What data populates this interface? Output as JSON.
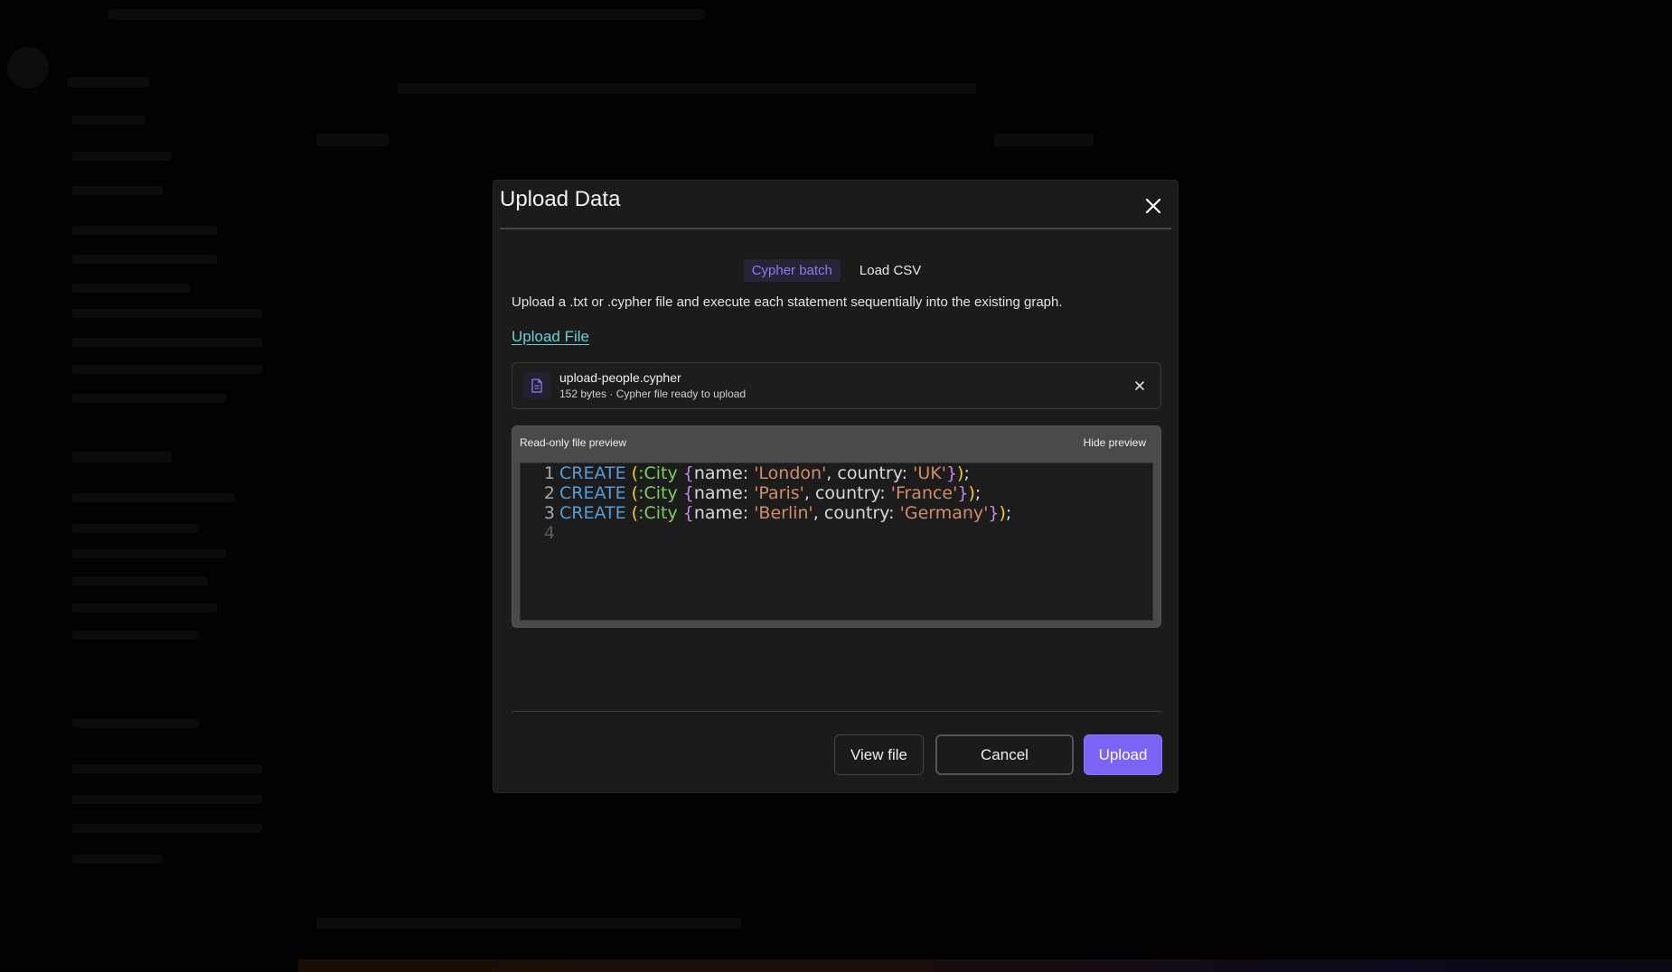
{
  "modal": {
    "title": "Upload Data",
    "tabs": [
      {
        "label": "Cypher batch",
        "active": true
      },
      {
        "label": "Load CSV",
        "active": false
      }
    ],
    "description": "Upload a .txt or .cypher file and execute each statement sequentially into the existing graph.",
    "upload_link": "Upload File",
    "file": {
      "name": "upload-people.cypher",
      "meta": "152 bytes · Cypher file ready to upload",
      "icon": "file-icon"
    },
    "preview": {
      "label": "Read-only file preview",
      "hide_label": "Hide preview",
      "line_numbers": [
        "1",
        "2",
        "3",
        "4"
      ],
      "lines": [
        {
          "kw": "CREATE",
          "label": ":City",
          "name": "'London'",
          "country": "'UK'"
        },
        {
          "kw": "CREATE",
          "label": ":City",
          "name": "'Paris'",
          "country": "'France'"
        },
        {
          "kw": "CREATE",
          "label": ":City",
          "name": "'Berlin'",
          "country": "'Germany'"
        }
      ],
      "prop_name_key": "name:",
      "prop_country_key": "country:"
    },
    "buttons": {
      "view_file": "View file",
      "cancel": "Cancel",
      "upload": "Upload"
    }
  },
  "colors": {
    "accent": "#7a63f5",
    "tab_active_text": "#8d7cf0",
    "link": "#6ccfd8",
    "keyword": "#569cd6",
    "string": "#d18d6a",
    "label": "#7ecf5a"
  }
}
